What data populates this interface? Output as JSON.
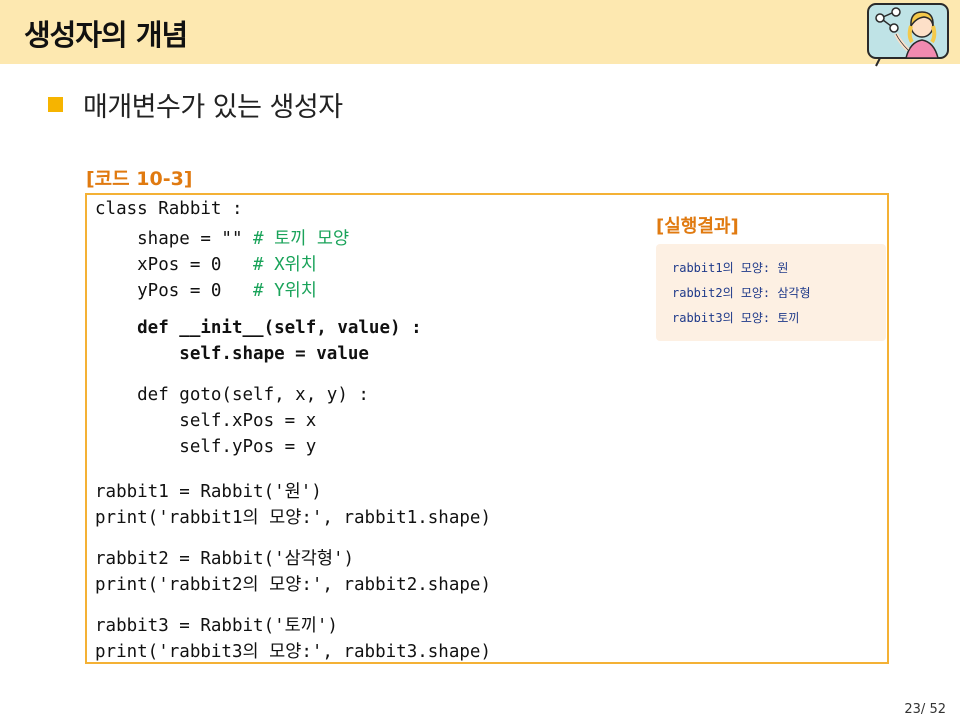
{
  "header": {
    "title": "생성자의 개념"
  },
  "bullet": {
    "text": "매개변수가 있는 생성자"
  },
  "code": {
    "caption": "[코드 10-3]",
    "lines": [
      {
        "code": "class Rabbit :",
        "comment": ""
      },
      {
        "code": "    shape = \"\" ",
        "comment": "# 토끼 모양"
      },
      {
        "code": "    xPos = 0   ",
        "comment": "# X위치"
      },
      {
        "code": "    yPos = 0   ",
        "comment": "# Y위치"
      },
      {
        "code": "    def __init__(self, value) :",
        "comment": ""
      },
      {
        "code": "        self.shape = value",
        "comment": ""
      },
      {
        "code": "    def goto(self, x, y) :",
        "comment": ""
      },
      {
        "code": "        self.xPos = x",
        "comment": ""
      },
      {
        "code": "        self.yPos = y",
        "comment": ""
      },
      {
        "code": "rabbit1 = Rabbit('원')",
        "comment": ""
      },
      {
        "code": "print('rabbit1의 모양:', rabbit1.shape)",
        "comment": ""
      },
      {
        "code": "rabbit2 = Rabbit('삼각형')",
        "comment": ""
      },
      {
        "code": "print('rabbit2의 모양:', rabbit2.shape)",
        "comment": ""
      },
      {
        "code": "rabbit3 = Rabbit('토끼')",
        "comment": ""
      },
      {
        "code": "print('rabbit3의 모양:', rabbit3.shape)",
        "comment": ""
      }
    ]
  },
  "result": {
    "caption": "[실행결과]",
    "lines": [
      "rabbit1의 모양: 원",
      "rabbit2의 모양: 삼각형",
      "rabbit3의 모양: 토끼"
    ]
  },
  "page": {
    "number": "23/ 52"
  }
}
